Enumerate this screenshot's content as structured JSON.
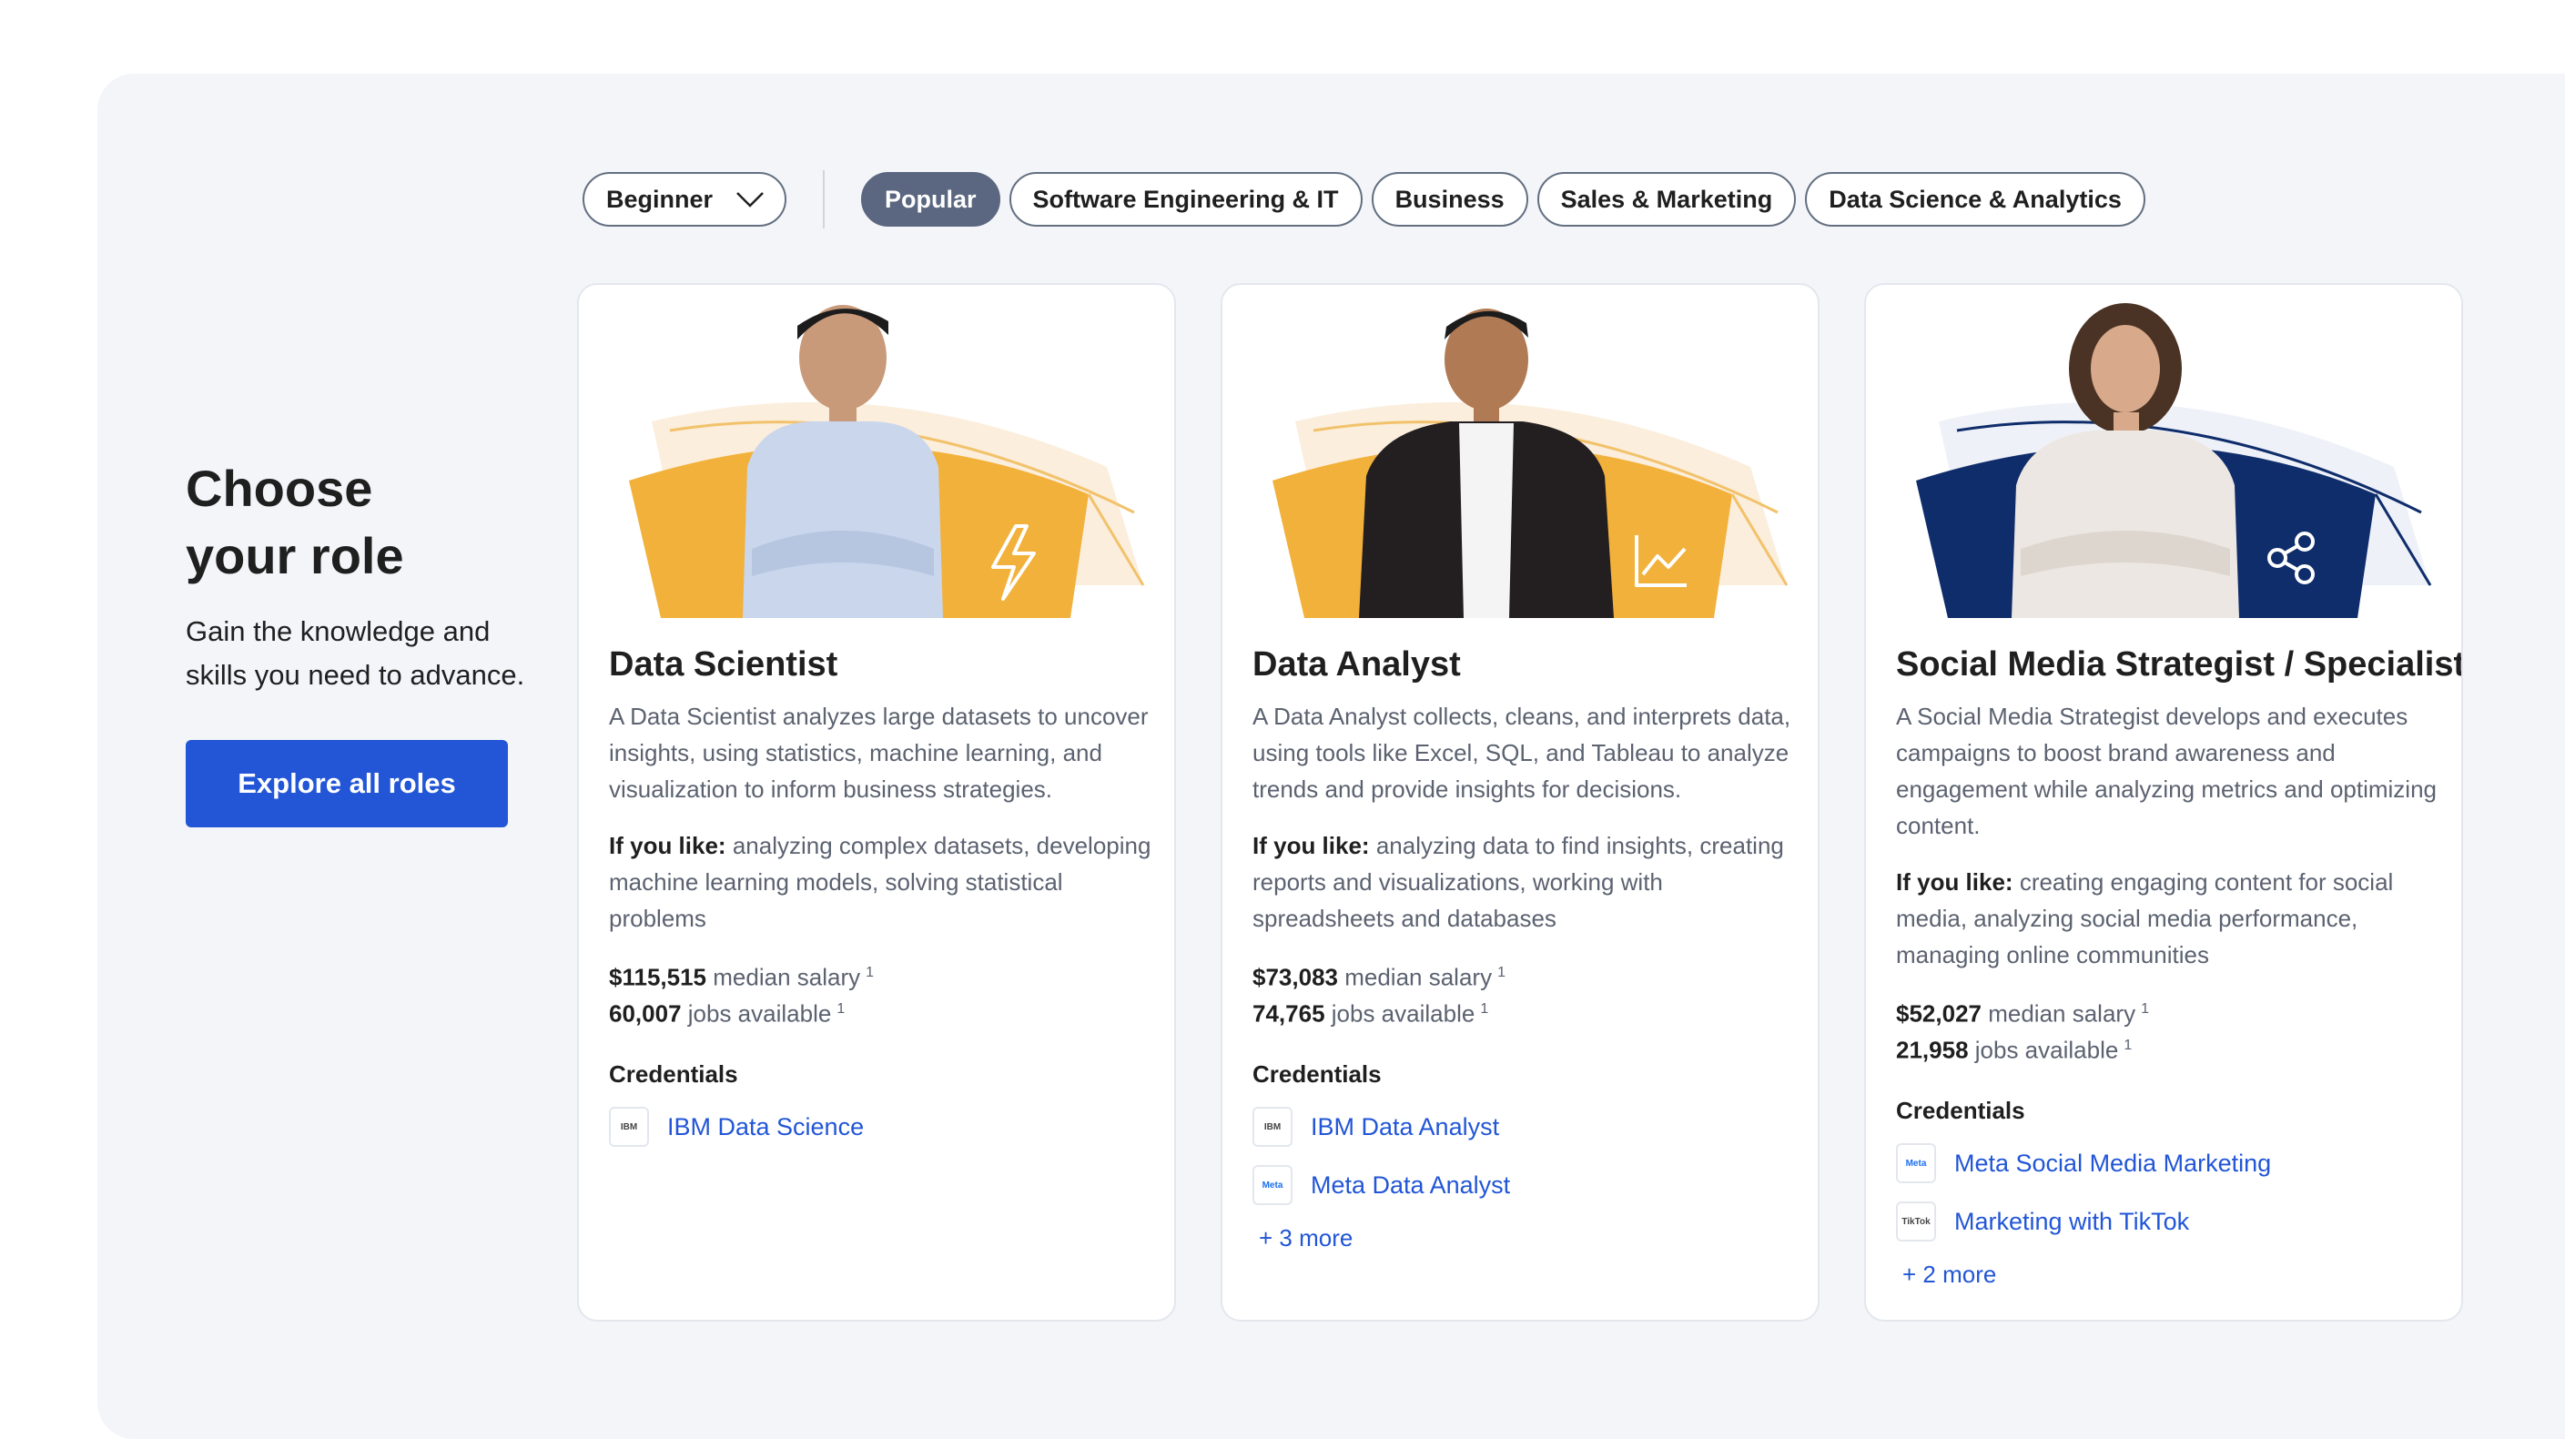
{
  "filters": {
    "level_select": "Beginner",
    "tabs": [
      {
        "label": "Popular",
        "active": true
      },
      {
        "label": "Software Engineering & IT",
        "active": false
      },
      {
        "label": "Business",
        "active": false
      },
      {
        "label": "Sales & Marketing",
        "active": false
      },
      {
        "label": "Data Science & Analytics",
        "active": false
      }
    ]
  },
  "intro": {
    "title_line1": "Choose",
    "title_line2": "your role",
    "subtitle_line1": "Gain the knowledge and",
    "subtitle_line2": "skills you need to advance.",
    "button": "Explore all roles"
  },
  "labels": {
    "if_you_like": "If you like:",
    "median_salary": "median salary",
    "jobs_available": "jobs available",
    "footnote": "1",
    "credentials": "Credentials"
  },
  "colors": {
    "accent_blue": "#2256d6",
    "panel_bg": "#f3f5f9",
    "pill_active": "#5b6780",
    "hero_yellow": "#f2b13b",
    "hero_navy": "#0f2d6b"
  },
  "cards": [
    {
      "title": "Data Scientist",
      "hero_icon": "lightning-icon",
      "description": "A Data Scientist analyzes large datasets to uncover insights, using statistics, machine learning, and visualization to inform business strategies.",
      "likes": "analyzing complex datasets, developing machine learning models, solving statistical problems",
      "salary": "$115,515",
      "jobs": "60,007",
      "credentials": [
        {
          "logo": "IBM",
          "name": "IBM Data Science"
        }
      ],
      "more": ""
    },
    {
      "title": "Data Analyst",
      "hero_icon": "line-chart-icon",
      "description": "A Data Analyst collects, cleans, and interprets data, using tools like Excel, SQL, and Tableau to analyze trends and provide insights for decisions.",
      "likes": "analyzing data to find insights, creating reports and visualizations, working with spreadsheets and databases",
      "salary": "$73,083",
      "jobs": "74,765",
      "credentials": [
        {
          "logo": "IBM",
          "name": "IBM Data Analyst"
        },
        {
          "logo": "Meta",
          "name": "Meta Data Analyst"
        }
      ],
      "more": "+ 3 more"
    },
    {
      "title": "Social Media Strategist / Specialist",
      "hero_icon": "share-icon",
      "description": "A Social Media Strategist develops and executes campaigns to boost brand awareness and engagement while analyzing metrics and optimizing content.",
      "likes": "creating engaging content for social media, analyzing social media performance, managing online communities",
      "salary": "$52,027",
      "jobs": "21,958",
      "credentials": [
        {
          "logo": "Meta",
          "name": "Meta Social Media Marketing"
        },
        {
          "logo": "TikTok",
          "name": "Marketing with TikTok"
        }
      ],
      "more": "+ 2 more"
    }
  ]
}
